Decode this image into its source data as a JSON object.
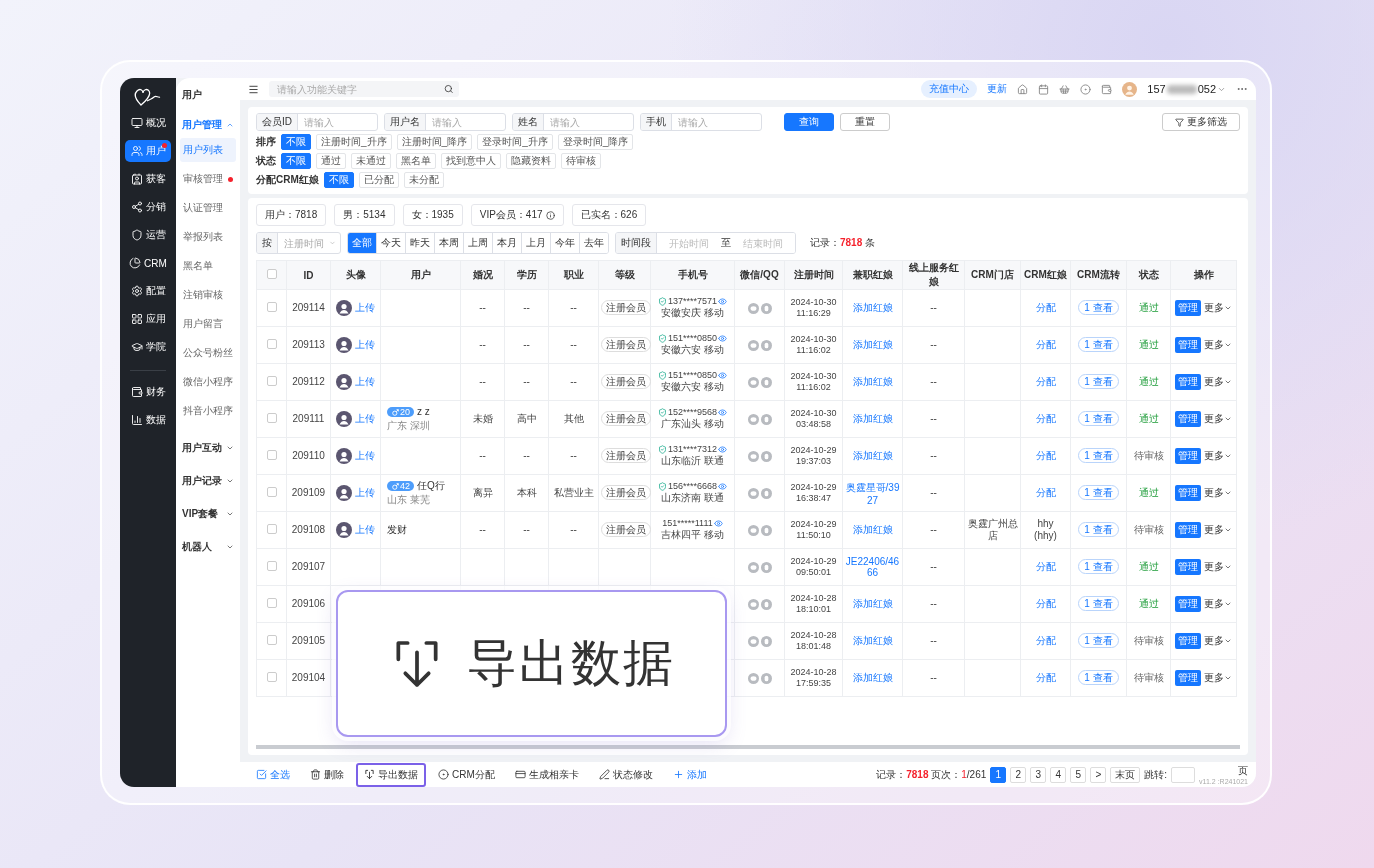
{
  "topbar": {
    "search_placeholder": "请输入功能关键字",
    "recharge": "充值中心",
    "update": "更新",
    "account_prefix": "157",
    "account_suffix": "052"
  },
  "sidebar": {
    "items": [
      {
        "label": "概况",
        "kind": "monitor",
        "selected": false,
        "badge": false
      },
      {
        "label": "用户",
        "kind": "users",
        "selected": true,
        "badge": true
      },
      {
        "label": "获客",
        "kind": "contact",
        "selected": false,
        "badge": false
      },
      {
        "label": "分销",
        "kind": "share",
        "selected": false,
        "badge": false
      },
      {
        "label": "运营",
        "kind": "shield",
        "selected": false,
        "badge": false
      },
      {
        "label": "CRM",
        "kind": "pie",
        "selected": false,
        "badge": false
      },
      {
        "label": "配置",
        "kind": "settings",
        "selected": false,
        "badge": false
      },
      {
        "label": "应用",
        "kind": "grid",
        "selected": false,
        "badge": false
      },
      {
        "label": "学院",
        "kind": "cap",
        "selected": false,
        "badge": false
      }
    ],
    "bottom_items": [
      {
        "label": "财务",
        "kind": "wallet",
        "selected": false,
        "badge": false
      },
      {
        "label": "数据",
        "kind": "chart",
        "selected": false,
        "badge": false
      }
    ]
  },
  "subnav": {
    "title": "用户",
    "groups": [
      {
        "label": "用户管理",
        "expanded": true,
        "children": [
          {
            "label": "用户列表",
            "selected": true,
            "alert": false
          },
          {
            "label": "审核管理",
            "selected": false,
            "alert": true
          },
          {
            "label": "认证管理",
            "selected": false,
            "alert": false
          },
          {
            "label": "举报列表",
            "selected": false,
            "alert": false
          },
          {
            "label": "黑名单",
            "selected": false,
            "alert": false
          },
          {
            "label": "注销审核",
            "selected": false,
            "alert": false
          },
          {
            "label": "用户留言",
            "selected": false,
            "alert": false
          },
          {
            "label": "公众号粉丝",
            "selected": false,
            "alert": false
          },
          {
            "label": "微信小程序",
            "selected": false,
            "alert": false
          },
          {
            "label": "抖音小程序",
            "selected": false,
            "alert": false
          }
        ]
      },
      {
        "label": "用户互动",
        "expanded": false
      },
      {
        "label": "用户记录",
        "expanded": false
      },
      {
        "label": "VIP套餐",
        "expanded": false
      },
      {
        "label": "机器人",
        "expanded": false
      }
    ]
  },
  "filters": {
    "fields": [
      {
        "label": "会员ID",
        "placeholder": "请输入"
      },
      {
        "label": "用户名",
        "placeholder": "请输入"
      },
      {
        "label": "姓名",
        "placeholder": "请输入"
      },
      {
        "label": "手机",
        "placeholder": "请输入"
      }
    ],
    "buttons": [
      {
        "label": "查询",
        "primary": true
      },
      {
        "label": "重置",
        "primary": false
      }
    ],
    "more": "更多筛选",
    "option_rows": [
      {
        "label": "排序",
        "options": [
          {
            "label": "不限",
            "selected": true
          },
          {
            "label": "注册时间_升序",
            "selected": false
          },
          {
            "label": "注册时间_降序",
            "selected": false
          },
          {
            "label": "登录时间_升序",
            "selected": false
          },
          {
            "label": "登录时间_降序",
            "selected": false
          }
        ]
      },
      {
        "label": "状态",
        "options": [
          {
            "label": "不限",
            "selected": true
          },
          {
            "label": "通过",
            "selected": false
          },
          {
            "label": "未通过",
            "selected": false
          },
          {
            "label": "黑名单",
            "selected": false
          },
          {
            "label": "找到意中人",
            "selected": false
          },
          {
            "label": "隐藏资料",
            "selected": false
          },
          {
            "label": "待审核",
            "selected": false
          }
        ]
      },
      {
        "label": "分配CRM红娘",
        "options": [
          {
            "label": "不限",
            "selected": true
          },
          {
            "label": "已分配",
            "selected": false
          },
          {
            "label": "未分配",
            "selected": false
          }
        ]
      }
    ]
  },
  "stats": [
    {
      "text": "用户：7818",
      "info": false
    },
    {
      "text": "男：5134",
      "info": false
    },
    {
      "text": "女：1935",
      "info": false
    },
    {
      "text": "VIP会员：417",
      "info": true
    },
    {
      "text": "已实名：626",
      "info": false
    }
  ],
  "date_filter": {
    "by": "按",
    "field_placeholder": "注册时间",
    "ranges": [
      {
        "label": "全部",
        "selected": true
      },
      {
        "label": "今天",
        "selected": false
      },
      {
        "label": "昨天",
        "selected": false
      },
      {
        "label": "本周",
        "selected": false
      },
      {
        "label": "上周",
        "selected": false
      },
      {
        "label": "本月",
        "selected": false
      },
      {
        "label": "上月",
        "selected": false
      },
      {
        "label": "今年",
        "selected": false
      },
      {
        "label": "去年",
        "selected": false
      }
    ],
    "period": "时间段",
    "start_placeholder": "开始时间",
    "to": "至",
    "end_placeholder": "结束时间",
    "record_label": "记录：",
    "record_count": "7818",
    "record_unit": "条"
  },
  "table": {
    "all_checked": false,
    "columns": [
      "ID",
      "头像",
      "用户",
      "婚况",
      "学历",
      "职业",
      "等级",
      "手机号",
      "微信/QQ",
      "注册时间",
      "兼职红娘",
      "线上服务红娘",
      "CRM门店",
      "CRM红娘",
      "CRM流转",
      "状态",
      "操作"
    ],
    "rows": [
      {
        "id": "209114",
        "checked": false,
        "upload": "上传",
        "marital": "--",
        "education": "--",
        "job": "--",
        "level": "注册会员",
        "phone": {
          "number": "137****7571",
          "verified": true,
          "location": "安徽安庆 移动"
        },
        "reg_date": "2024-10-30",
        "reg_time": "11:16:29",
        "matchmaker": "添加红娘",
        "online": "--",
        "crm": {
          "kind": "link",
          "lines": [
            "分配"
          ]
        },
        "transfer": "1 查看",
        "status": {
          "text": "通过",
          "kind": "passed"
        },
        "manage": "管理",
        "more": "更多"
      },
      {
        "id": "209113",
        "checked": false,
        "upload": "上传",
        "marital": "--",
        "education": "--",
        "job": "--",
        "level": "注册会员",
        "phone": {
          "number": "151****0850",
          "verified": true,
          "location": "安徽六安 移动"
        },
        "reg_date": "2024-10-30",
        "reg_time": "11:16:02",
        "matchmaker": "添加红娘",
        "online": "--",
        "crm": {
          "kind": "link",
          "lines": [
            "分配"
          ]
        },
        "transfer": "1 查看",
        "status": {
          "text": "通过",
          "kind": "passed"
        },
        "manage": "管理",
        "more": "更多"
      },
      {
        "id": "209112",
        "checked": false,
        "upload": "上传",
        "marital": "--",
        "education": "--",
        "job": "--",
        "level": "注册会员",
        "phone": {
          "number": "151****0850",
          "verified": true,
          "location": "安徽六安 移动"
        },
        "reg_date": "2024-10-30",
        "reg_time": "11:16:02",
        "matchmaker": "添加红娘",
        "online": "--",
        "crm": {
          "kind": "link",
          "lines": [
            "分配"
          ]
        },
        "transfer": "1 查看",
        "status": {
          "text": "通过",
          "kind": "passed"
        },
        "manage": "管理",
        "more": "更多"
      },
      {
        "id": "209111",
        "checked": false,
        "upload": "上传",
        "user": {
          "age": "20",
          "name": "z z",
          "location": "广东 深圳"
        },
        "marital": "未婚",
        "education": "高中",
        "job": "其他",
        "level": "注册会员",
        "phone": {
          "number": "152****9568",
          "verified": true,
          "location": "广东汕头 移动"
        },
        "reg_date": "2024-10-30",
        "reg_time": "03:48:58",
        "matchmaker": "添加红娘",
        "online": "--",
        "crm": {
          "kind": "link",
          "lines": [
            "分配"
          ]
        },
        "transfer": "1 查看",
        "status": {
          "text": "通过",
          "kind": "passed"
        },
        "manage": "管理",
        "more": "更多"
      },
      {
        "id": "209110",
        "checked": false,
        "upload": "上传",
        "marital": "--",
        "education": "--",
        "job": "--",
        "level": "注册会员",
        "phone": {
          "number": "131****7312",
          "verified": true,
          "location": "山东临沂 联通"
        },
        "reg_date": "2024-10-29",
        "reg_time": "19:37:03",
        "matchmaker": "添加红娘",
        "online": "--",
        "crm": {
          "kind": "link",
          "lines": [
            "分配"
          ]
        },
        "transfer": "1 查看",
        "status": {
          "text": "待审核",
          "kind": "pending"
        },
        "manage": "管理",
        "more": "更多"
      },
      {
        "id": "209109",
        "checked": false,
        "upload": "上传",
        "user": {
          "age": "42",
          "name": "任Q行",
          "location": "山东 莱芜"
        },
        "marital": "离异",
        "education": "本科",
        "job": "私营业主",
        "level": "注册会员",
        "phone": {
          "number": "156****6668",
          "verified": true,
          "location": "山东济南 联通"
        },
        "reg_date": "2024-10-29",
        "reg_time": "16:38:47",
        "matchmaker": "奥霆星哥/3927",
        "online": "--",
        "crm": {
          "kind": "link",
          "lines": [
            "分配"
          ]
        },
        "transfer": "1 查看",
        "status": {
          "text": "通过",
          "kind": "passed"
        },
        "manage": "管理",
        "more": "更多"
      },
      {
        "id": "209108",
        "checked": false,
        "upload": "上传",
        "user": {
          "name": "发财"
        },
        "marital": "--",
        "education": "--",
        "job": "--",
        "level": "注册会员",
        "phone": {
          "number": "151*****1111",
          "verified": false,
          "location": "吉林四平 移动"
        },
        "reg_date": "2024-10-29",
        "reg_time": "11:50:10",
        "matchmaker": "添加红娘",
        "online": "--",
        "store": "奥霆广州总店",
        "crm": {
          "kind": "text",
          "lines": [
            "hhy",
            "(hhy)"
          ]
        },
        "transfer": "1 查看",
        "status": {
          "text": "待审核",
          "kind": "pending"
        },
        "manage": "管理",
        "more": "更多"
      },
      {
        "id": "209107",
        "checked": false,
        "reg_date": "2024-10-29",
        "reg_time": "09:50:01",
        "matchmaker": "JE22406/4666",
        "online": "--",
        "crm": {
          "kind": "link",
          "lines": [
            "分配"
          ]
        },
        "transfer": "1 查看",
        "status": {
          "text": "通过",
          "kind": "passed"
        },
        "manage": "管理",
        "more": "更多"
      },
      {
        "id": "209106",
        "checked": false,
        "reg_date": "2024-10-28",
        "reg_time": "18:10:01",
        "matchmaker": "添加红娘",
        "online": "--",
        "crm": {
          "kind": "link",
          "lines": [
            "分配"
          ]
        },
        "transfer": "1 查看",
        "status": {
          "text": "通过",
          "kind": "passed"
        },
        "manage": "管理",
        "more": "更多"
      },
      {
        "id": "209105",
        "checked": false,
        "reg_date": "2024-10-28",
        "reg_time": "18:01:48",
        "matchmaker": "添加红娘",
        "online": "--",
        "crm": {
          "kind": "link",
          "lines": [
            "分配"
          ]
        },
        "transfer": "1 查看",
        "status": {
          "text": "待审核",
          "kind": "pending"
        },
        "manage": "管理",
        "more": "更多"
      },
      {
        "id": "209104",
        "checked": false,
        "reg_date": "2024-10-28",
        "reg_time": "17:59:35",
        "matchmaker": "添加红娘",
        "online": "--",
        "crm": {
          "kind": "link",
          "lines": [
            "分配"
          ]
        },
        "transfer": "1 查看",
        "status": {
          "text": "待审核",
          "kind": "pending"
        },
        "manage": "管理",
        "more": "更多"
      }
    ]
  },
  "bottom_bar": {
    "actions": [
      {
        "label": "全选",
        "kind": "select-all",
        "highlighted": false
      },
      {
        "label": "删除",
        "kind": "delete",
        "highlighted": false
      },
      {
        "label": "导出数据",
        "kind": "export",
        "highlighted": true
      },
      {
        "label": "CRM分配",
        "kind": "crm",
        "highlighted": false
      },
      {
        "label": "生成相亲卡",
        "kind": "card",
        "highlighted": false
      },
      {
        "label": "状态修改",
        "kind": "edit",
        "highlighted": false
      },
      {
        "label": "添加",
        "kind": "add",
        "highlighted": false
      }
    ],
    "records_label": "记录：",
    "records": "7818",
    "page_label": "页次：",
    "page_current": "1",
    "page_total": "/261",
    "pages": [
      {
        "label": "1",
        "selected": true
      },
      {
        "label": "2",
        "selected": false
      },
      {
        "label": "3",
        "selected": false
      },
      {
        "label": "4",
        "selected": false
      },
      {
        "label": "5",
        "selected": false
      }
    ],
    "next": ">",
    "last": "末页",
    "jump_label": "跳转:",
    "page_unit": "页",
    "version": "v11.2 :R241021"
  },
  "callout": {
    "label": "导出数据"
  }
}
